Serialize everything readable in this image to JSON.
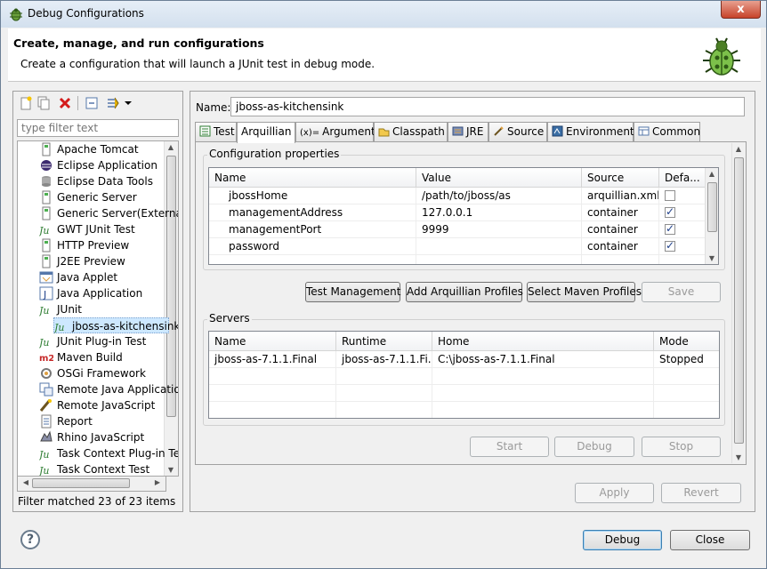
{
  "window": {
    "title": "Debug Configurations",
    "close_label": "x"
  },
  "header": {
    "title": "Create, manage, and run configurations",
    "subtitle": "Create a configuration that will launch a JUnit test in debug mode."
  },
  "left": {
    "filter_placeholder": "type filter text",
    "items": [
      {
        "label": "Apache Tomcat",
        "icon": "tomcat-icon",
        "indent": 1
      },
      {
        "label": "Eclipse Application",
        "icon": "eclipse-icon",
        "indent": 1
      },
      {
        "label": "Eclipse Data Tools",
        "icon": "database-icon",
        "indent": 1
      },
      {
        "label": "Generic Server",
        "icon": "server-icon",
        "indent": 1
      },
      {
        "label": "Generic Server(External",
        "icon": "server-icon",
        "indent": 1
      },
      {
        "label": "GWT JUnit Test",
        "icon": "junit-icon",
        "indent": 1
      },
      {
        "label": "HTTP Preview",
        "icon": "server-icon",
        "indent": 1
      },
      {
        "label": "J2EE Preview",
        "icon": "server-icon",
        "indent": 1
      },
      {
        "label": "Java Applet",
        "icon": "applet-icon",
        "indent": 1
      },
      {
        "label": "Java Application",
        "icon": "java-app-icon",
        "indent": 1
      },
      {
        "label": "JUnit",
        "icon": "junit-icon",
        "indent": 1
      },
      {
        "label": "jboss-as-kitchensink",
        "icon": "junit-icon",
        "indent": 2,
        "selected": true
      },
      {
        "label": "JUnit Plug-in Test",
        "icon": "junit-icon",
        "indent": 1
      },
      {
        "label": "Maven Build",
        "icon": "maven-icon",
        "indent": 1
      },
      {
        "label": "OSGi Framework",
        "icon": "osgi-icon",
        "indent": 1
      },
      {
        "label": "Remote Java Applicatio",
        "icon": "remote-java-icon",
        "indent": 1
      },
      {
        "label": "Remote JavaScript",
        "icon": "remote-js-icon",
        "indent": 1
      },
      {
        "label": "Report",
        "icon": "report-icon",
        "indent": 1
      },
      {
        "label": "Rhino JavaScript",
        "icon": "rhino-icon",
        "indent": 1
      },
      {
        "label": "Task Context Plug-in Te",
        "icon": "junit-icon",
        "indent": 1
      },
      {
        "label": "Task Context Test",
        "icon": "junit-icon",
        "indent": 1
      }
    ],
    "filter_status": "Filter matched 23 of 23 items"
  },
  "config": {
    "name_label": "Name:",
    "name_value": "jboss-as-kitchensink",
    "tabs": [
      "Test",
      "Arquillian",
      "Arguments",
      "Classpath",
      "JRE",
      "Source",
      "Environment",
      "Common"
    ],
    "tab_prefixes": [
      "",
      "",
      "(x)=",
      "",
      "",
      "",
      "",
      ""
    ],
    "props_group": "Configuration properties",
    "props_headers": [
      "Name",
      "Value",
      "Source",
      "Defa..."
    ],
    "props_rows": [
      {
        "name": "jbossHome",
        "value": "/path/to/jboss/as",
        "source": "arquillian.xml",
        "def": false
      },
      {
        "name": "managementAddress",
        "value": "127.0.0.1",
        "source": "container",
        "def": true
      },
      {
        "name": "managementPort",
        "value": "9999",
        "source": "container",
        "def": true
      },
      {
        "name": "password",
        "value": "",
        "source": "container",
        "def": true
      }
    ],
    "buttons": {
      "test_mgmt": "Test Management",
      "add_profiles": "Add Arquillian Profiles",
      "select_maven": "Select Maven Profiles",
      "save": "Save"
    },
    "servers_group": "Servers",
    "server_headers": [
      "Name",
      "Runtime",
      "Home",
      "Mode"
    ],
    "server_rows": [
      {
        "name": "jboss-as-7.1.1.Final",
        "runtime": "jboss-as-7.1.1.Fi...",
        "home": "C:\\jboss-as-7.1.1.Final",
        "mode": "Stopped"
      }
    ],
    "server_buttons": {
      "start": "Start",
      "debug": "Debug",
      "stop": "Stop"
    },
    "apply": "Apply",
    "revert": "Revert"
  },
  "footer": {
    "help": "?",
    "debug": "Debug",
    "close": "Close"
  },
  "colors": {
    "selection": "#cde8ff",
    "accent": "#3c7fb1",
    "title_bg": "#d3e0ee"
  }
}
